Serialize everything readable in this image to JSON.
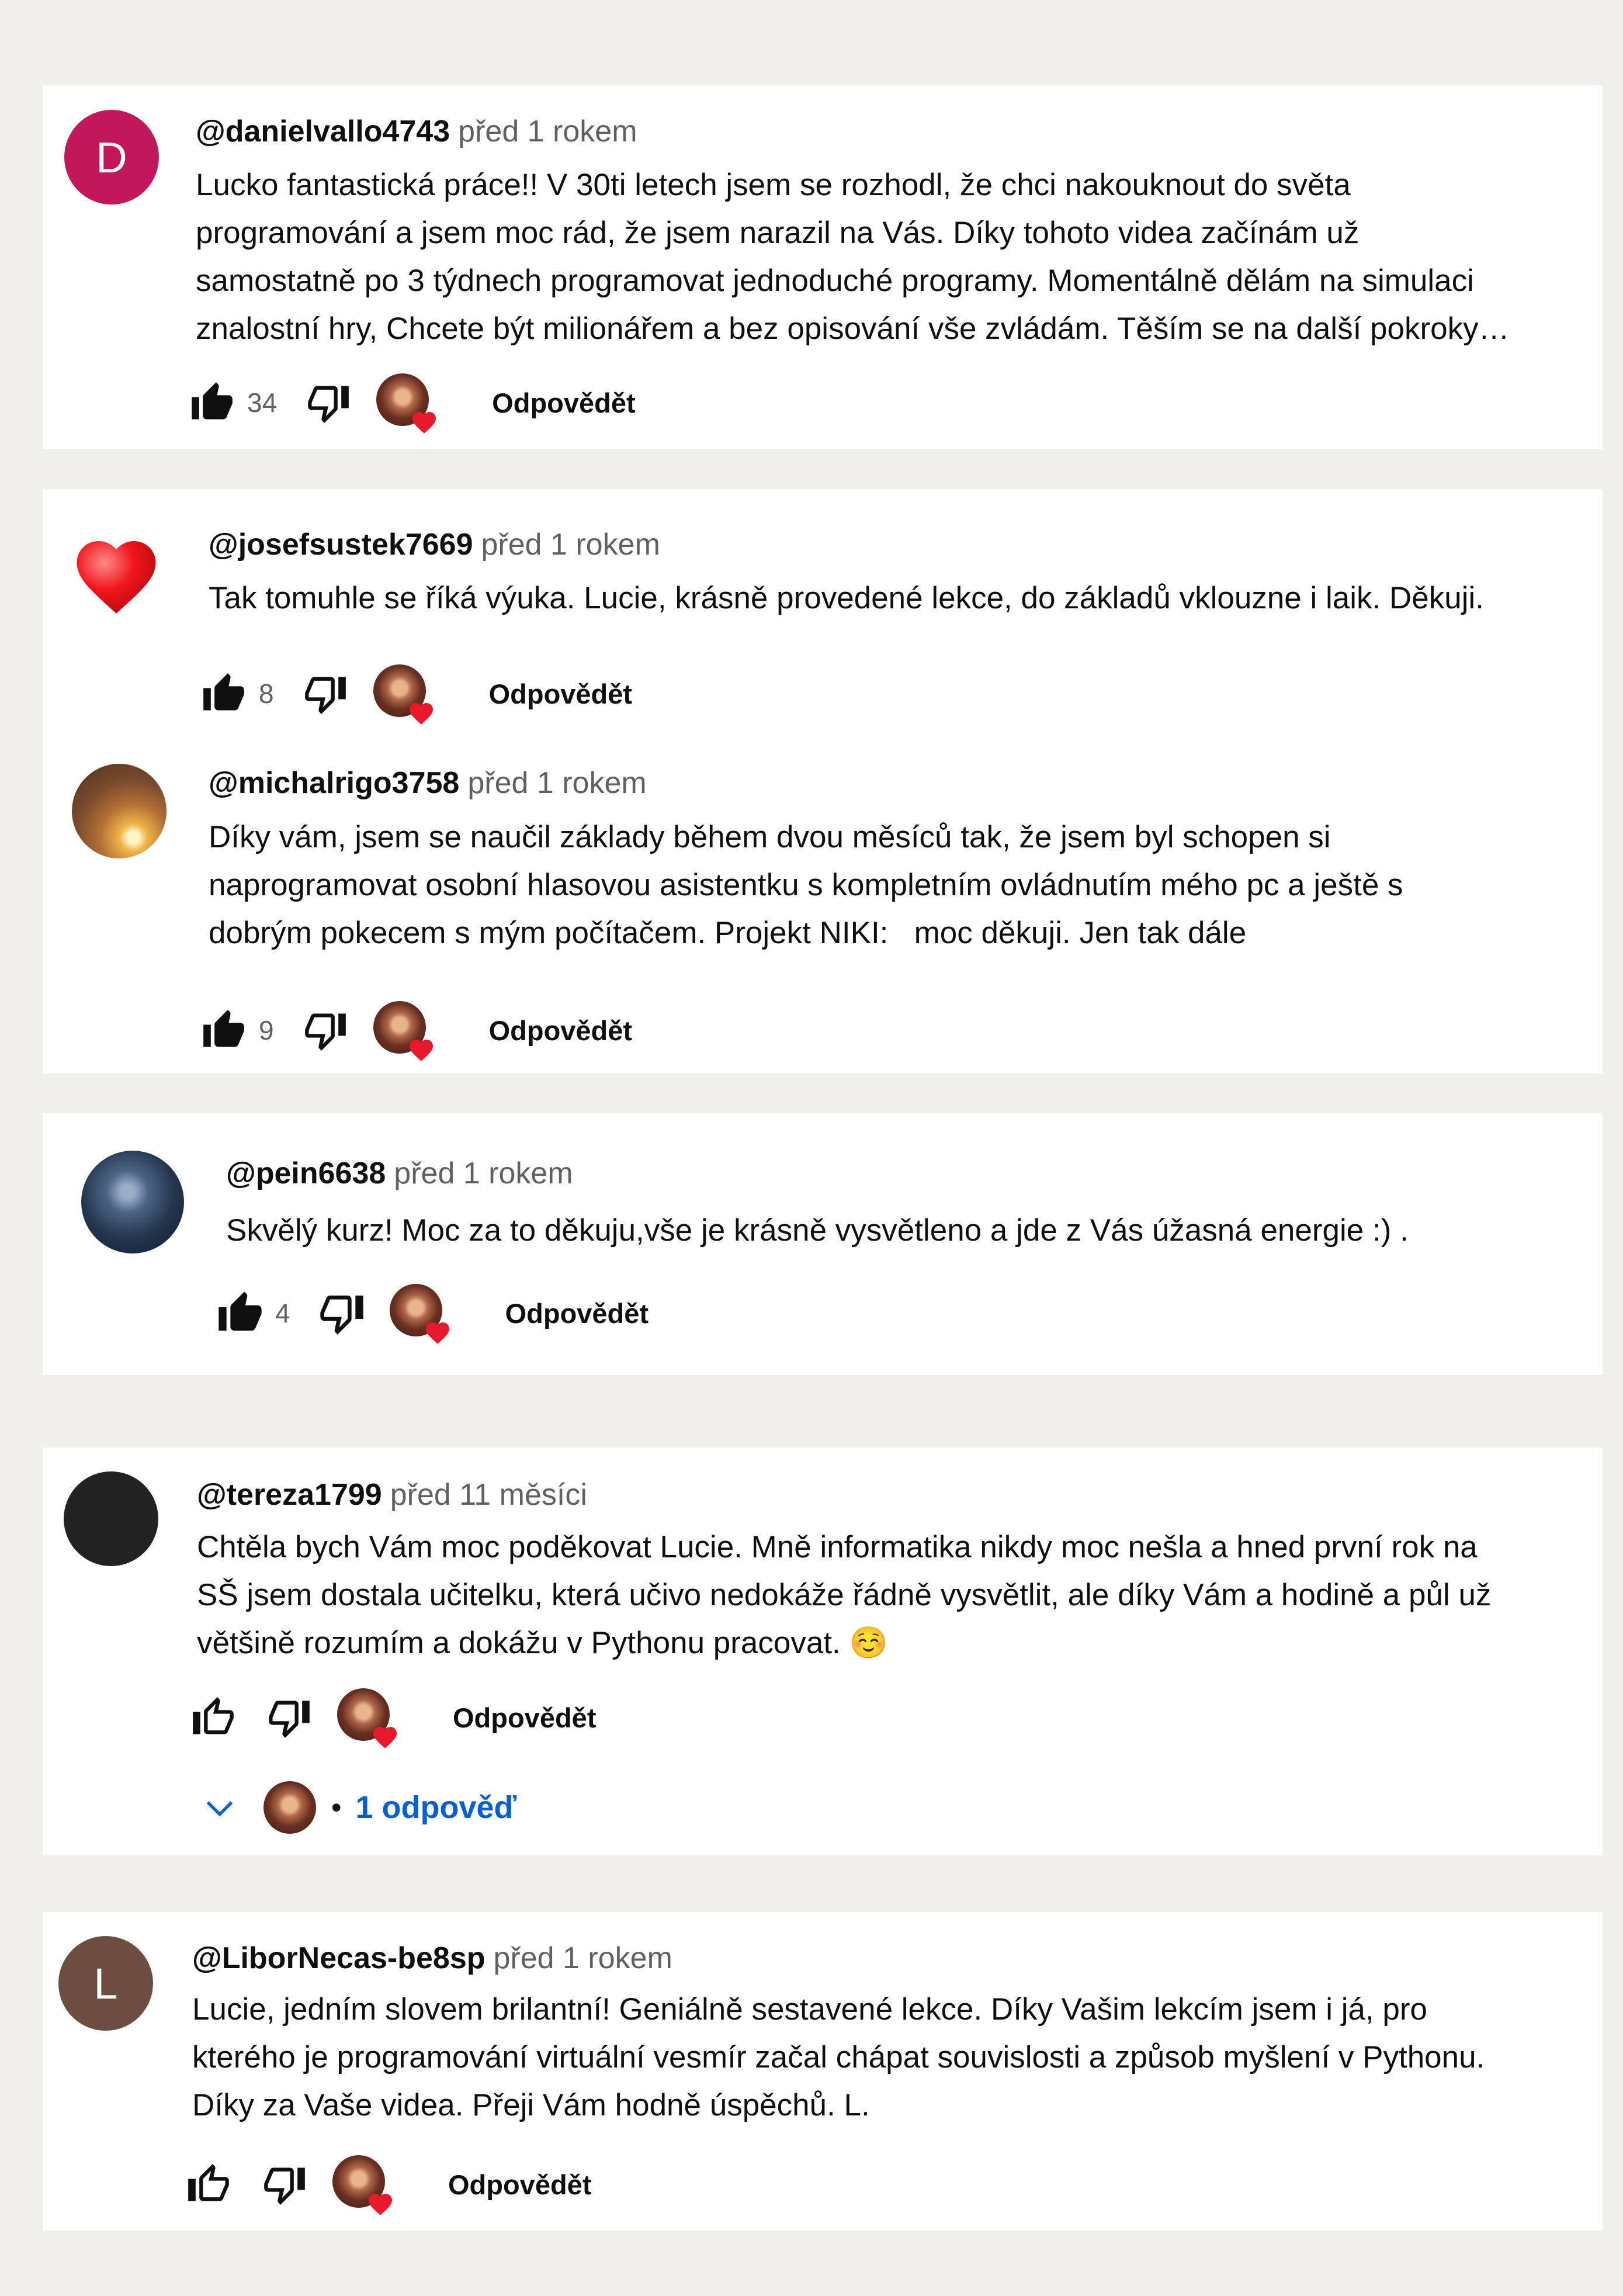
{
  "comments": [
    {
      "avatar_letter": "D",
      "handle": "@danielvallo4743",
      "time": "před 1 rokem",
      "lines": [
        "Lucko fantastická práce!! V 30ti letech jsem se rozhodl, že chci nakouknout do světa",
        "programování a jsem moc rád, že jsem narazil na Vás. Díky tohoto videa začínám už",
        "samostatně po 3 týdnech programovat jednoduché programy. Momentálně dělám na simulaci",
        "znalostní hry, Chcete být milionářem a bez opisování vše zvládám. Těším se na další pokroky…"
      ],
      "likes": "34",
      "reply_label": "Odpovědět"
    },
    {
      "avatar_icon": "heart-avatar",
      "handle": "@josefsustek7669",
      "time": "před 1 rokem",
      "lines": [
        "Tak tomuhle se říká výuka. Lucie, krásně provedené lekce, do základů vklouzne i laik. Děkuji."
      ],
      "likes": "8",
      "reply_label": "Odpovědět"
    },
    {
      "handle": "@michalrigo3758",
      "time": "před 1 rokem",
      "lines": [
        "Díky vám, jsem se naučil základy během dvou měsíců tak, že jsem byl schopen si",
        "naprogramovat osobní hlasovou asistentku s kompletním ovládnutím mého pc a ještě s",
        "dobrým pokecem s mým počítačem. Projekt NIKI:   moc děkuji. Jen tak dále"
      ],
      "likes": "9",
      "reply_label": "Odpovědět"
    },
    {
      "handle": "@pein6638",
      "time": "před 1 rokem",
      "lines": [
        "Skvělý kurz! Moc za to děkuju,vše je krásně vysvětleno a jde z Vás úžasná energie :) ."
      ],
      "likes": "4",
      "reply_label": "Odpovědět"
    },
    {
      "handle": "@tereza1799",
      "time": "před 11 měsíci",
      "lines": [
        "Chtěla bych Vám moc poděkovat Lucie. Mně informatika nikdy moc nešla a hned první rok na",
        "SŠ jsem dostala učitelku, která učivo nedokáže řádně vysvětlit, ale díky Vám a hodině a půl už",
        "většině rozumím a dokážu v Pythonu pracovat. ☺️"
      ],
      "likes": "",
      "reply_label": "Odpovědět",
      "replies_dot": "•",
      "replies_label": "1 odpověď"
    },
    {
      "avatar_letter": "L",
      "handle": "@LiborNecas-be8sp",
      "time": "před 1 rokem",
      "lines": [
        "Lucie, jedním slovem brilantní! Geniálně sestavené lekce. Díky Vašim lekcím jsem i já, pro",
        "kterého je programování virtuální vesmír začal chápat souvislosti a způsob myšlení v Pythonu.",
        "Díky za Vaše videa. Přeji Vám hodně úspěchů. L."
      ],
      "likes": "",
      "reply_label": "Odpovědět"
    }
  ],
  "colors": {
    "page_bg": "#f0efea",
    "card_bg": "#ffffff",
    "link_blue": "#065fd4",
    "heart_red": "#e8192c",
    "muted": "#606060"
  }
}
